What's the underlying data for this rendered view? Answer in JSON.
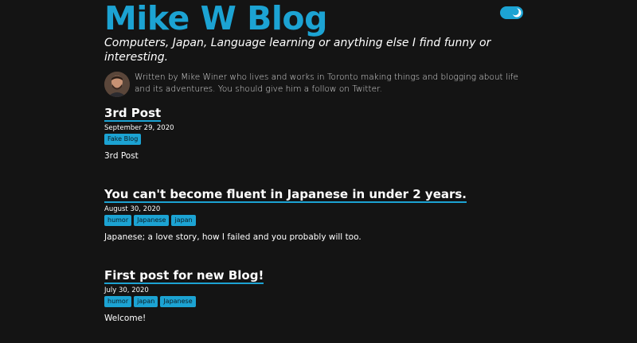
{
  "site": {
    "title": "Mike W Blog",
    "tagline": "Computers, Japan, Language learning or anything else I find funny or interesting.",
    "bio_prefix": "Written by ",
    "bio_author": "Mike Winer",
    "bio_rest": " who lives and works in Toronto making things and blogging about life and its adventures. ",
    "bio_follow": "You should give him a follow on Twitter."
  },
  "theme_toggle": {
    "icon": "moon-icon",
    "mode": "dark"
  },
  "colors": {
    "accent": "#1ca3d3",
    "background": "#141414",
    "text": "#ffffff"
  },
  "posts": [
    {
      "title": "3rd Post",
      "date": "September 29, 2020",
      "tags": [
        "Fake Blog"
      ],
      "summary": "3rd Post"
    },
    {
      "title": "You can't become fluent in Japanese in under 2 years.",
      "date": "August 30, 2020",
      "tags": [
        "humor",
        "Japanese",
        "japan"
      ],
      "summary": "Japanese; a love story, how I failed and you probably will too."
    },
    {
      "title": "First post for new Blog!",
      "date": "July 30, 2020",
      "tags": [
        "humor",
        "japan",
        "Japanese"
      ],
      "summary": "Welcome!"
    }
  ]
}
